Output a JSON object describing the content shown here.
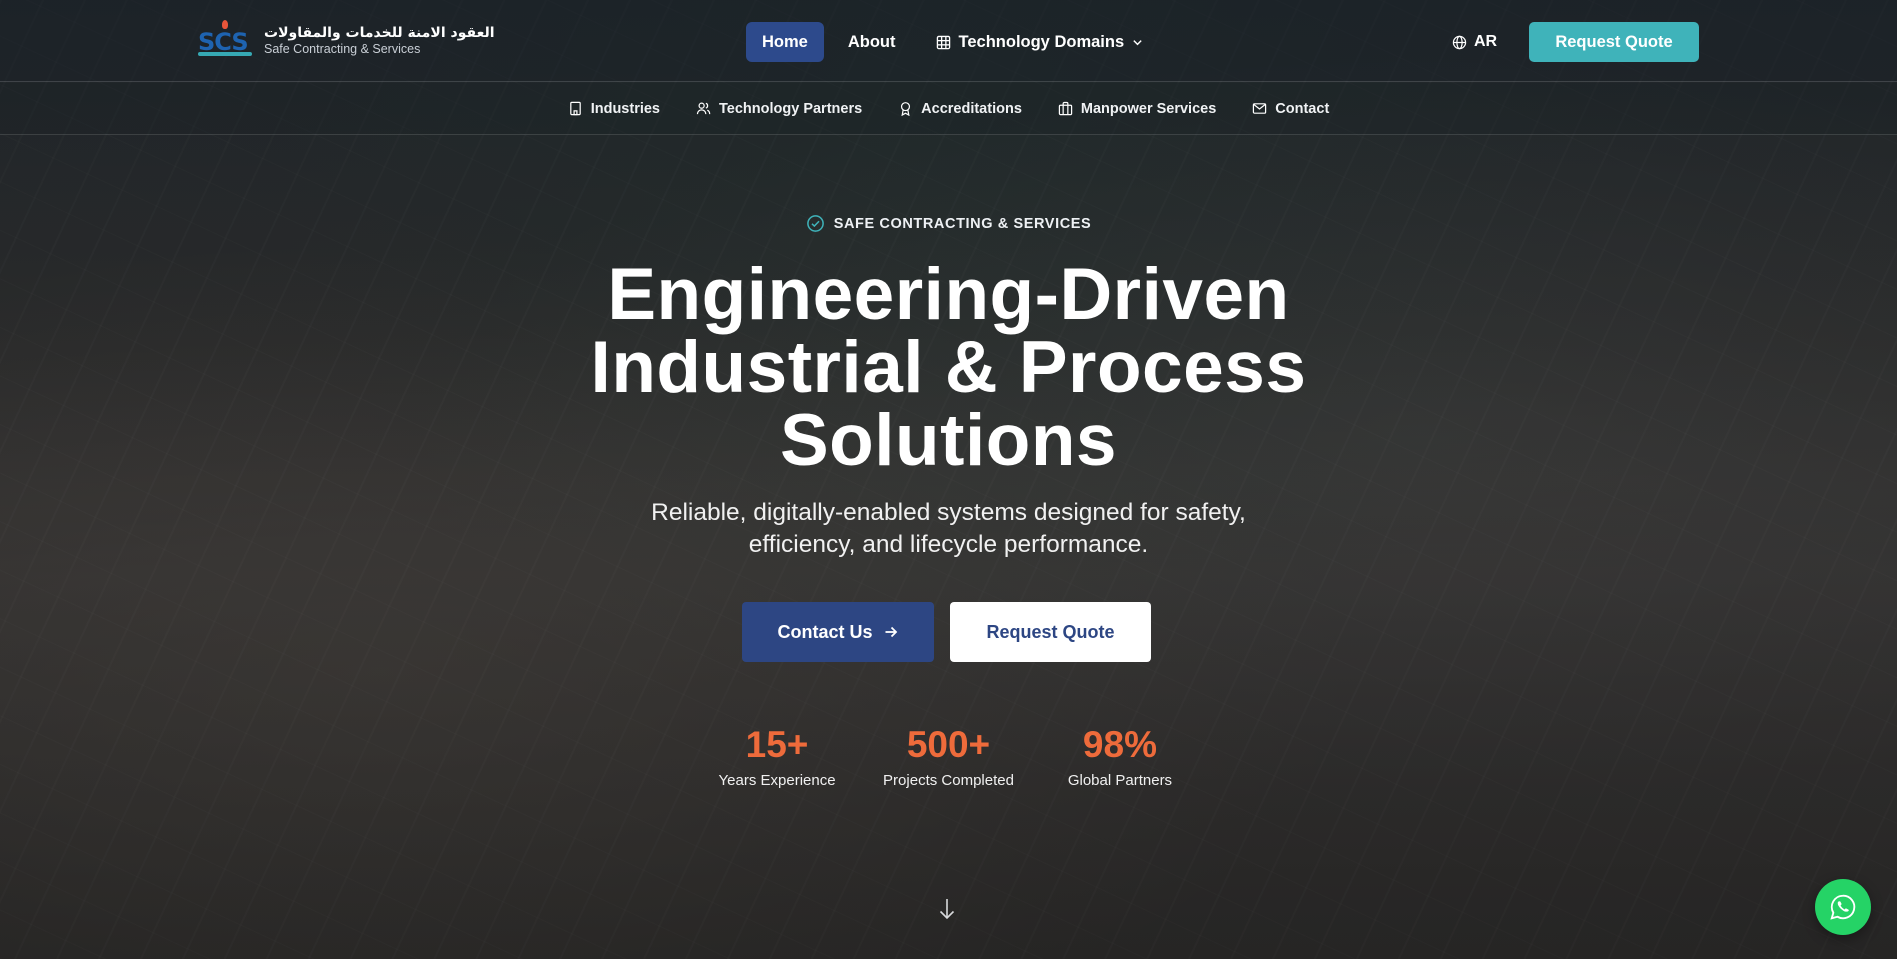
{
  "brand": {
    "name_ar": "العقود الامنة للخدمات والمقاولات",
    "name_en": "Safe Contracting & Services",
    "logo_letters": "SCS",
    "colors": {
      "primary": "#2d4683",
      "accent": "#3fb3ba",
      "highlight": "#ee6b3b",
      "whatsapp": "#25d366"
    }
  },
  "nav": {
    "home": "Home",
    "about": "About",
    "domains": "Technology Domains",
    "domains_icon": "grid-icon",
    "lang": "AR",
    "lang_icon": "globe-icon",
    "quote": "Request Quote"
  },
  "subnav": [
    {
      "label": "Industries",
      "icon": "building-icon"
    },
    {
      "label": "Technology Partners",
      "icon": "users-icon"
    },
    {
      "label": "Accreditations",
      "icon": "award-icon"
    },
    {
      "label": "Manpower Services",
      "icon": "briefcase-icon"
    },
    {
      "label": "Contact",
      "icon": "mail-icon"
    }
  ],
  "hero": {
    "tagline": "SAFE CONTRACTING & SERVICES",
    "title_lines": [
      "Engineering-Driven",
      "Industrial & Process",
      "Solutions"
    ],
    "subtitle_lines": [
      "Reliable, digitally-enabled systems designed for safety,",
      "efficiency, and lifecycle performance."
    ],
    "cta_primary": "Contact Us",
    "cta_secondary": "Request Quote"
  },
  "stats": [
    {
      "value": "15+",
      "label": "Years Experience"
    },
    {
      "value": "500+",
      "label": "Projects Completed"
    },
    {
      "value": "98%",
      "label": "Global Partners"
    }
  ]
}
